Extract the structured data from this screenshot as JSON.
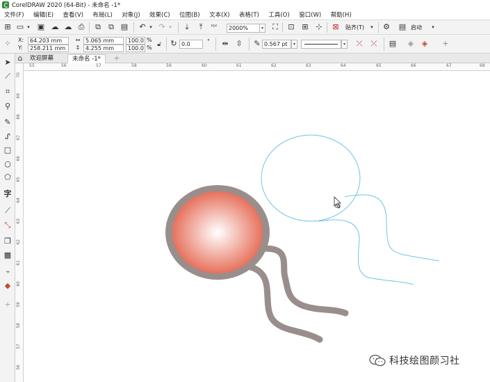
{
  "window": {
    "title": "CorelDRAW 2020 (64-Bit) - 未命名 -1*"
  },
  "menu": [
    "文件(F)",
    "编辑(E)",
    "查看(V)",
    "布局(L)",
    "对象(J)",
    "效果(C)",
    "位图(B)",
    "文本(X)",
    "表格(T)",
    "工具(O)",
    "窗口(W)",
    "帮助(H)"
  ],
  "toolbar": {
    "zoom": "2000%",
    "snap_label": "贴齐(T)",
    "launch_label": "启动"
  },
  "props": {
    "x_label": "X:",
    "x_value": "64.203 mm",
    "y_label": "Y:",
    "y_value": "258.211 mm",
    "w_value": "5.065 mm",
    "h_value": "4.255 mm",
    "scale_x": "100.0",
    "scale_y": "100.0",
    "pct": "%",
    "angle": "0.0",
    "degree": "°",
    "outline_width": "0.567 pt"
  },
  "tabs": {
    "welcome": "欢迎屏幕",
    "doc": "未命名 -1*"
  },
  "ruler": {
    "h_ticks": [
      "55",
      "56",
      "57",
      "58",
      "59",
      "60",
      "61",
      "62",
      "63",
      "64",
      "65",
      "66",
      "67",
      "68"
    ],
    "v_ticks": [
      "70",
      "69",
      "68",
      "67",
      "66",
      "65",
      "64",
      "63",
      "62",
      "61",
      "60",
      "59",
      "58",
      "57",
      "56"
    ]
  },
  "colors": {
    "gradient_outer": "#e2553c",
    "gradient_inner": "#ffffff",
    "ring": "#998e8b",
    "wire": "#6ec3e8"
  },
  "watermark": "科技绘图颜习社"
}
